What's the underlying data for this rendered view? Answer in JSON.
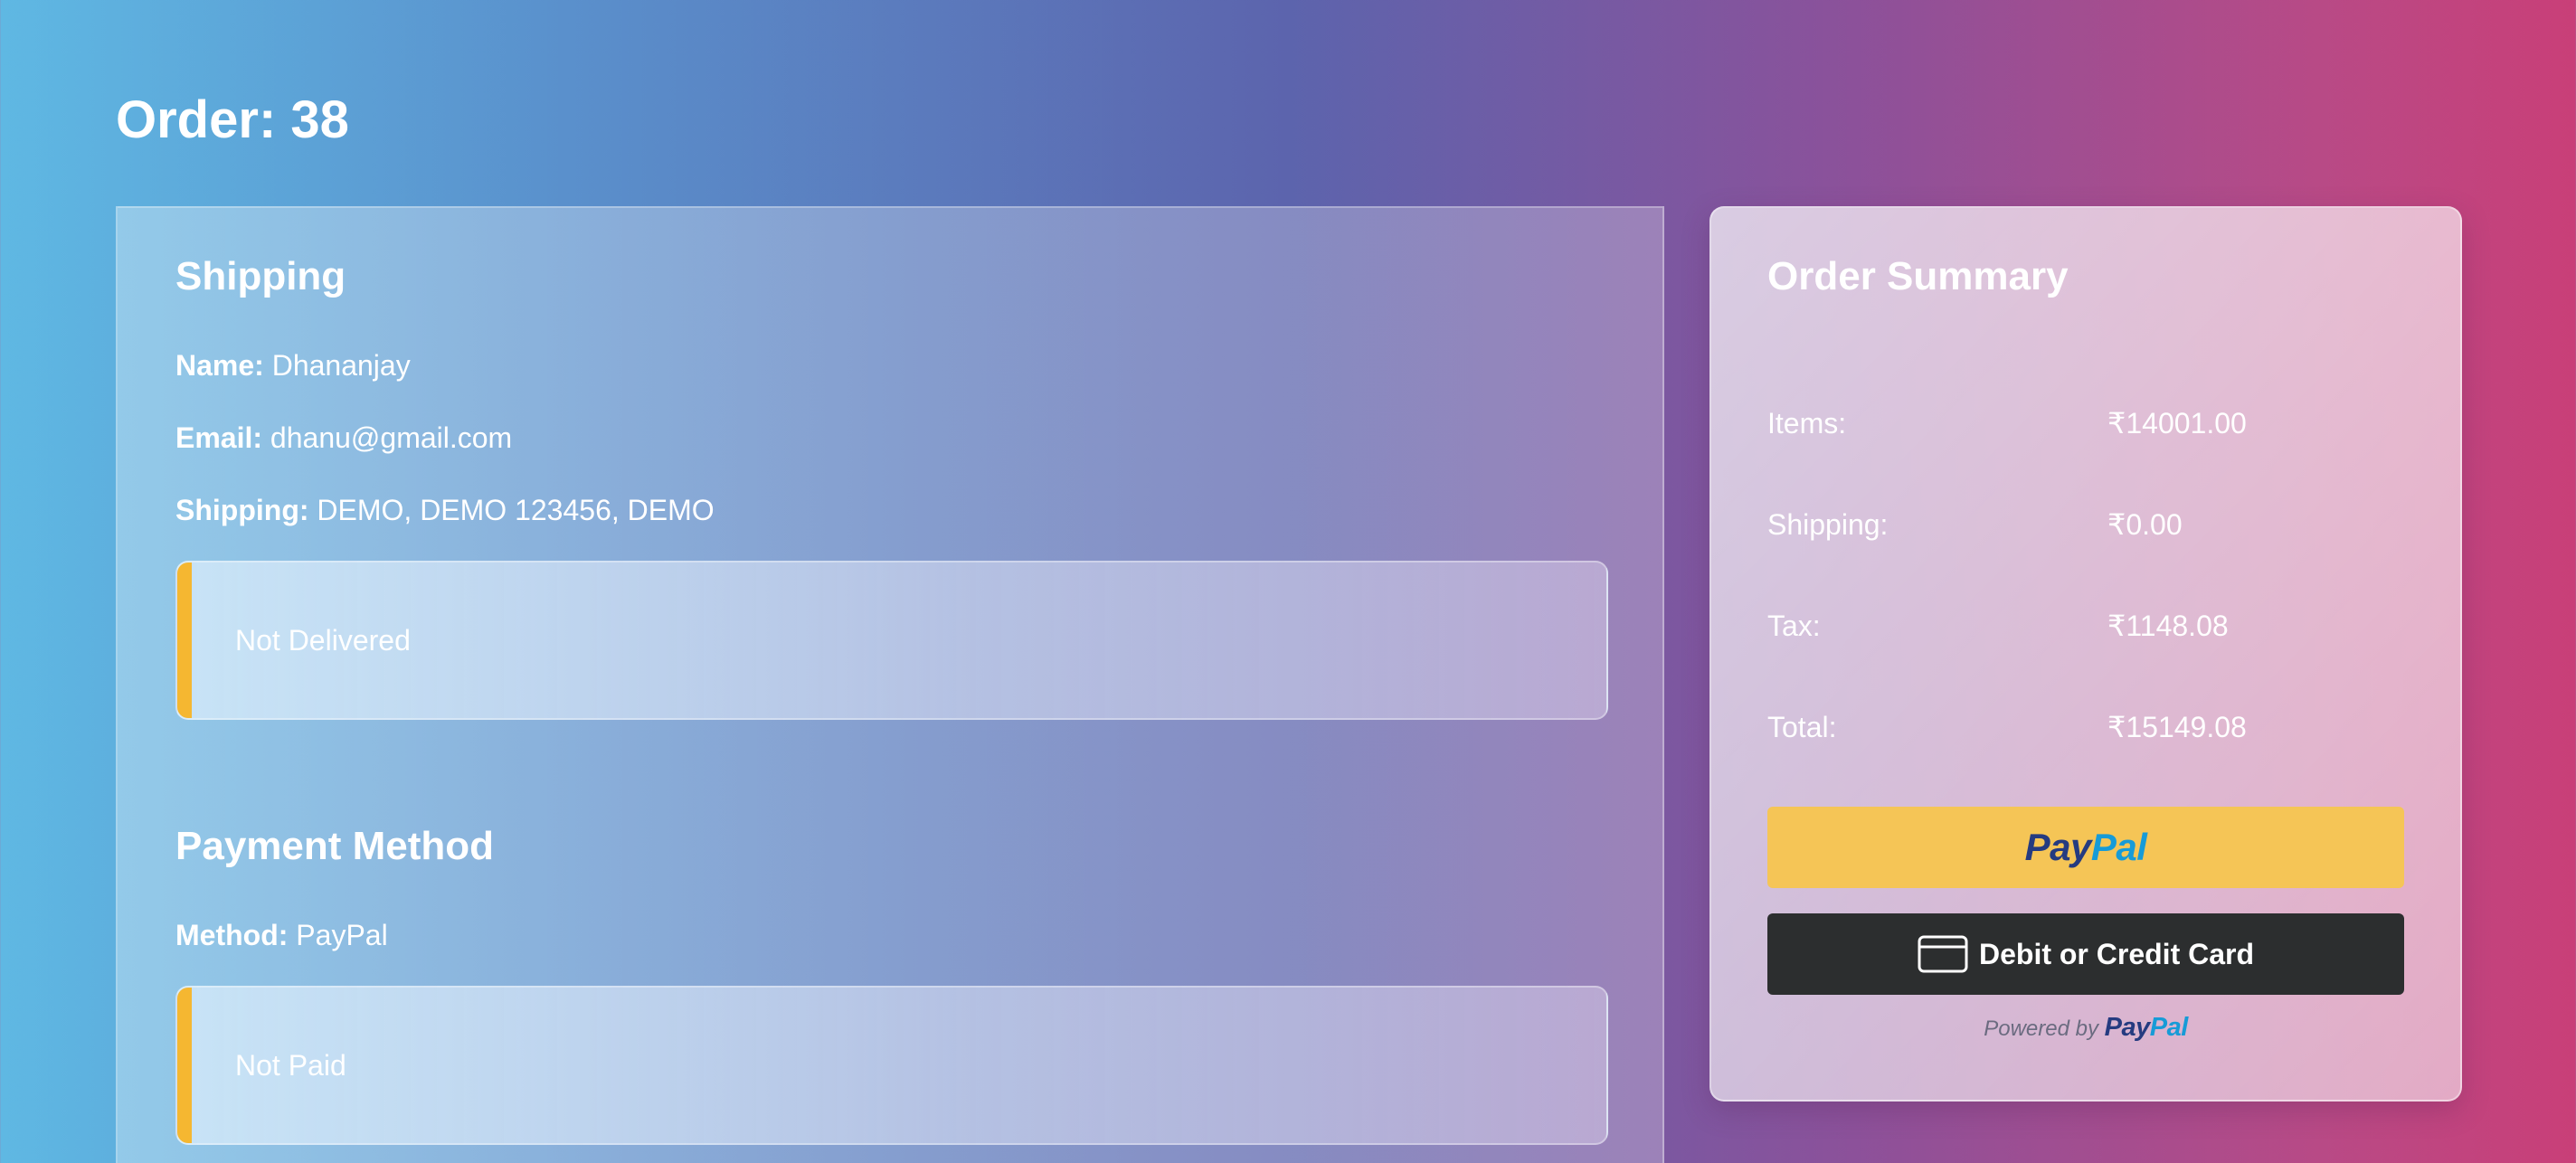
{
  "page": {
    "title": "Order: 38"
  },
  "shipping": {
    "heading": "Shipping",
    "name_label": "Name:",
    "name_value": "Dhananjay",
    "email_label": "Email:",
    "email_value": "dhanu@gmail.com",
    "address_label": "Shipping:",
    "address_value": "DEMO, DEMO 123456, DEMO",
    "delivery_status": "Not Delivered"
  },
  "payment": {
    "heading": "Payment Method",
    "method_label": "Method:",
    "method_value": "PayPal",
    "payment_status": "Not Paid"
  },
  "summary": {
    "heading": "Order Summary",
    "rows": [
      {
        "label": "Items:",
        "value": "₹14001.00"
      },
      {
        "label": "Shipping:",
        "value": "₹0.00"
      },
      {
        "label": "Tax:",
        "value": "₹1148.08"
      },
      {
        "label": "Total:",
        "value": "₹15149.08"
      }
    ],
    "paypal_logo_part1": "Pay",
    "paypal_logo_part2": "Pal",
    "card_button_label": "Debit or Credit Card",
    "powered_by_text": "Powered by"
  },
  "colors": {
    "status_accent": "#f5b731",
    "paypal_button": "#f5c556",
    "card_button": "#2c2e2f",
    "paypal_navy": "#253b80",
    "paypal_blue": "#179bd7"
  },
  "icons": {
    "card": "credit-card-icon"
  }
}
